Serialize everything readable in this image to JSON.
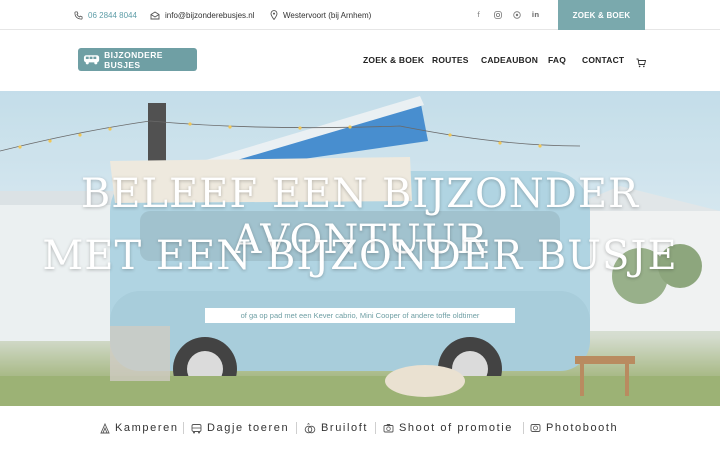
{
  "topbar": {
    "phone": "06 2844 8044",
    "email": "info@bijzonderebusjes.nl",
    "location": "Westervoort (bij Arnhem)",
    "socials": [
      "facebook-icon",
      "instagram-icon",
      "whatsapp-icon",
      "linkedin-icon"
    ],
    "cta_label": "ZOEK & BOEK"
  },
  "header": {
    "logo_text": "BIJZONDERE BUSJES",
    "nav": [
      "ZOEK & BOEK",
      "ROUTES",
      "CADEAUBON",
      "FAQ",
      "CONTACT"
    ]
  },
  "hero": {
    "title_line1": "BELEEF EEN BIJZONDER AVONTUUR",
    "title_line2": "MET EEN BIJZONDER BUSJE",
    "subtitle": "of ga op pad met een Kever cabrio, Mini Cooper of andere toffe oldtimer"
  },
  "categories": [
    {
      "label": "Kamperen",
      "icon": "camping-icon"
    },
    {
      "label": "Dagje toeren",
      "icon": "van-icon"
    },
    {
      "label": "Bruiloft",
      "icon": "rings-icon"
    },
    {
      "label": "Shoot of promotie",
      "icon": "camera-icon"
    },
    {
      "label": "Photobooth",
      "icon": "photobooth-icon"
    }
  ],
  "colors": {
    "accent": "#7aa9ad",
    "logo_bg": "#6f9fa4",
    "phone_text": "#5f9ea8"
  }
}
